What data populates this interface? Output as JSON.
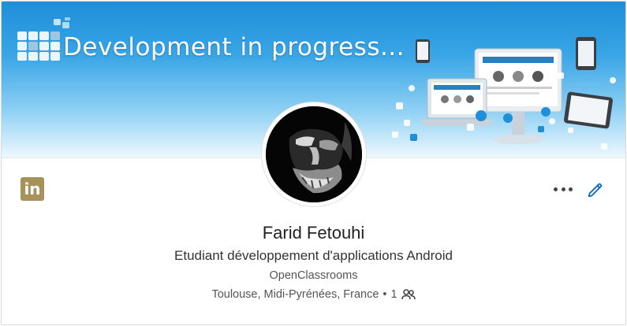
{
  "banner": {
    "title": "Development in progress..."
  },
  "profile": {
    "name": "Farid Fetouhi",
    "headline": "Etudiant développement d'applications Android",
    "company": "OpenClassrooms",
    "location": "Toulouse, Midi-Pyrénées, France",
    "separator": "•",
    "connections": "1"
  },
  "icons": {
    "brand": "linkedin-icon",
    "more": "more-dots-icon",
    "edit": "pencil-icon",
    "connections": "people-icon"
  },
  "colors": {
    "linkedin_badge": "#a8925c",
    "edit_blue": "#0a66c2",
    "banner_top": "#1e8ed8"
  }
}
